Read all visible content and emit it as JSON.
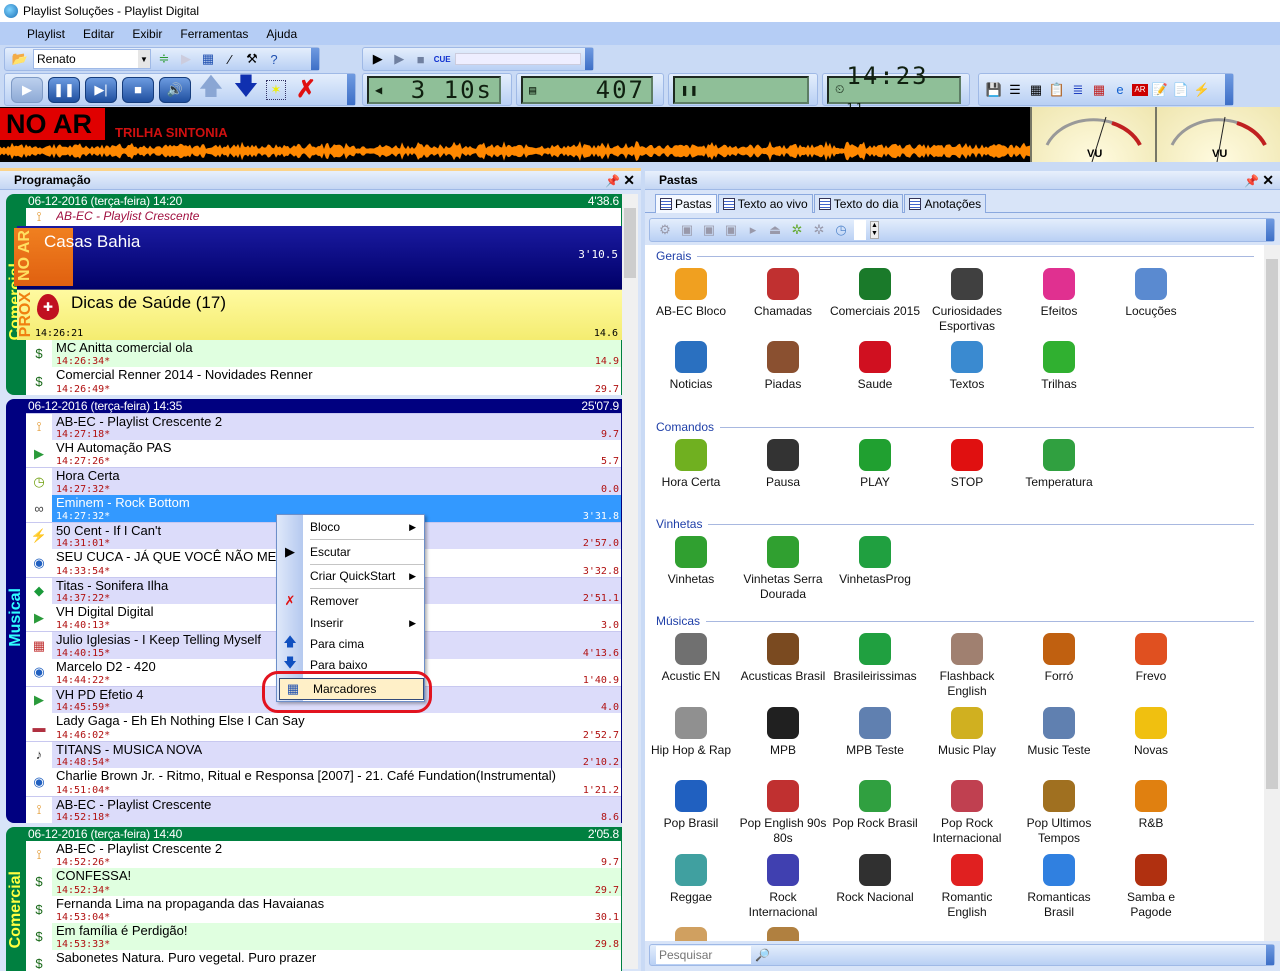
{
  "window": {
    "title": "Playlist Soluções - Playlist Digital"
  },
  "menu": [
    "Playlist",
    "Editar",
    "Exibir",
    "Ferramentas",
    "Ajuda"
  ],
  "toolbar": {
    "user_combo": "Renato",
    "cue_label": "CUE"
  },
  "displays": {
    "remaining": "3 10s",
    "count": "407",
    "clock": "14:23",
    "clock_seconds": "11"
  },
  "onair": {
    "label": "NO AR",
    "track": "TRILHA SINTONIA",
    "vu_label": "VU",
    "waveform_color": "#ff8800"
  },
  "left_panel": {
    "title": "Programação",
    "blocks": [
      {
        "kind": "com",
        "label": "Comercial",
        "header": "06-12-2016 (terça-feira) 14:20",
        "total": "4'38.6",
        "pre": {
          "title": "AB-EC - Playlist Crescente"
        },
        "now": {
          "badge": "NO AR",
          "title": "Casas Bahia",
          "duration": "3'10.5"
        },
        "next": {
          "badge": "PROX",
          "title": "Dicas de Saúde (17)",
          "time": "14:26:21",
          "duration": "14.6"
        },
        "rows": [
          {
            "title": "MC Anitta comercial ola",
            "time": "14:26:34*",
            "duration": "14.9",
            "bg": "g",
            "icon": "money-bag"
          },
          {
            "title": "Comercial Renner 2014 - Novidades Renner",
            "time": "14:26:49*",
            "duration": "29.7",
            "bg": "w",
            "icon": "money-bag"
          }
        ]
      },
      {
        "kind": "mus",
        "label": "Musical",
        "header": "06-12-2016 (terça-feira) 14:35",
        "total": "25'07.9",
        "rows": [
          {
            "title": "AB-EC - Playlist Crescente 2",
            "time": "14:27:18*",
            "duration": "9.7",
            "bg": "l",
            "icon": "antenna"
          },
          {
            "title": "VH Automação PAS",
            "time": "14:27:26*",
            "duration": "5.7",
            "bg": "w",
            "icon": "play"
          },
          {
            "title": "Hora Certa",
            "time": "14:27:32*",
            "duration": "0.0",
            "bg": "l",
            "icon": "clock"
          },
          {
            "title": "Eminem - Rock Bottom",
            "time": "14:27:32*",
            "duration": "3'31.8",
            "bg": "sel",
            "icon": "speakers"
          },
          {
            "title": "50 Cent - If I Can't",
            "time": "14:31:01*",
            "duration": "2'57.0",
            "bg": "l",
            "icon": "winamp"
          },
          {
            "title": "SEU CUCA -  JÁ QUE VOCÊ NÃO ME CONHECE",
            "time": "14:33:54*",
            "duration": "3'32.8",
            "bg": "w",
            "icon": "media-player"
          },
          {
            "title": "Titas - Sonifera Ilha",
            "time": "14:37:22*",
            "duration": "2'51.1",
            "bg": "l",
            "icon": "brazil-flag"
          },
          {
            "title": "VH Digital Digital",
            "time": "14:40:13*",
            "duration": "3.0",
            "bg": "w",
            "icon": "play"
          },
          {
            "title": "Julio Iglesias - I Keep Telling Myself",
            "time": "14:40:15*",
            "duration": "4'13.6",
            "bg": "l",
            "icon": "cube"
          },
          {
            "title": "Marcelo D2 - 420",
            "time": "14:44:22*",
            "duration": "1'40.9",
            "bg": "w",
            "icon": "media-player"
          },
          {
            "title": "VH PD Efetio 4",
            "time": "14:45:59*",
            "duration": "4.0",
            "bg": "l",
            "icon": "play"
          },
          {
            "title": "Lady Gaga - Eh Eh Nothing Else I Can Say",
            "time": "14:46:02*",
            "duration": "2'52.7",
            "bg": "w",
            "icon": "us-flag"
          },
          {
            "title": "TITANS - MUSICA NOVA",
            "time": "14:48:54*",
            "duration": "2'10.2",
            "bg": "l",
            "icon": "guitar"
          },
          {
            "title": "Charlie Brown Jr. - Ritmo, Ritual e Responsa [2007] - 21. Café Fundation(Instrumental)",
            "time": "14:51:04*",
            "duration": "1'21.2",
            "bg": "w",
            "icon": "media-player"
          },
          {
            "title": "AB-EC - Playlist Crescente",
            "time": "14:52:18*",
            "duration": "8.6",
            "bg": "l",
            "icon": "antenna"
          }
        ]
      },
      {
        "kind": "com",
        "label": "Comercial",
        "header": "06-12-2016 (terça-feira) 14:40",
        "total": "2'05.8",
        "rows": [
          {
            "title": "AB-EC - Playlist Crescente 2",
            "time": "14:52:26*",
            "duration": "9.7",
            "bg": "w",
            "icon": "antenna"
          },
          {
            "title": "CONFESSA!",
            "time": "14:52:34*",
            "duration": "29.7",
            "bg": "g",
            "icon": "money-bag"
          },
          {
            "title": "Fernanda Lima na propaganda das Havaianas",
            "time": "14:53:04*",
            "duration": "30.1",
            "bg": "w",
            "icon": "money-bag"
          },
          {
            "title": "Em família é Perdigão!",
            "time": "14:53:33*",
            "duration": "29.8",
            "bg": "g",
            "icon": "money-bag"
          },
          {
            "title": "Sabonetes Natura. Puro vegetal. Puro prazer",
            "time": "",
            "duration": "",
            "bg": "w",
            "icon": "money-bag"
          }
        ]
      }
    ]
  },
  "context_menu": [
    {
      "label": "Bloco",
      "submenu": true,
      "icon": ""
    },
    {
      "label": "Escutar",
      "icon": "play"
    },
    {
      "label": "Criar QuickStart",
      "submenu": true,
      "icon": ""
    },
    {
      "label": "Remover",
      "icon": "red-x"
    },
    {
      "label": "Inserir",
      "submenu": true,
      "icon": ""
    },
    {
      "label": "Para cima",
      "icon": "arrow-up"
    },
    {
      "label": "Para baixo",
      "icon": "arrow-down"
    },
    {
      "label": "Marcadores",
      "icon": "grid",
      "highlighted": true
    }
  ],
  "right_panel": {
    "title": "Pastas",
    "tabs": [
      "Pastas",
      "Texto ao vivo",
      "Texto do dia",
      "Anotações"
    ],
    "search_placeholder": "Pesquisar",
    "sections": [
      {
        "name": "Gerais",
        "items": [
          {
            "label": "AB-EC Bloco",
            "color": "#f0a020"
          },
          {
            "label": "Chamadas",
            "color": "#c03030"
          },
          {
            "label": "Comerciais 2015",
            "color": "#1a7a2a"
          },
          {
            "label": "Curiosidades Esportivas",
            "color": "#404040"
          },
          {
            "label": "Efeitos",
            "color": "#e03090"
          },
          {
            "label": "Locuções",
            "color": "#5a8ad0"
          },
          {
            "label": "Noticias",
            "color": "#2a70c0"
          },
          {
            "label": "Piadas",
            "color": "#8a5030"
          },
          {
            "label": "Saude",
            "color": "#d01020"
          },
          {
            "label": "Textos",
            "color": "#3a8ad0"
          },
          {
            "label": "Trilhas",
            "color": "#30b030"
          }
        ]
      },
      {
        "name": "Comandos",
        "items": [
          {
            "label": "Hora Certa",
            "color": "#70b020"
          },
          {
            "label": "Pausa",
            "color": "#333333"
          },
          {
            "label": "PLAY",
            "color": "#20a030"
          },
          {
            "label": "STOP",
            "color": "#e01010"
          },
          {
            "label": "Temperatura",
            "color": "#30a040"
          }
        ]
      },
      {
        "name": "Vinhetas",
        "items": [
          {
            "label": "Vinhetas",
            "color": "#30a030"
          },
          {
            "label": "Vinhetas Serra Dourada",
            "color": "#30a030"
          },
          {
            "label": "VinhetasProg",
            "color": "#20a040"
          }
        ]
      },
      {
        "name": "Músicas",
        "items": [
          {
            "label": "Acustic EN",
            "color": "#707070"
          },
          {
            "label": "Acusticas Brasil",
            "color": "#7a4a20"
          },
          {
            "label": "Brasileirissimas",
            "color": "#20a040"
          },
          {
            "label": "Flashback English",
            "color": "#a08070"
          },
          {
            "label": "Forró",
            "color": "#c06010"
          },
          {
            "label": "Frevo",
            "color": "#e05020"
          },
          {
            "label": "Hip Hop & Rap",
            "color": "#909090"
          },
          {
            "label": "MPB",
            "color": "#202020"
          },
          {
            "label": "MPB Teste",
            "color": "#6080b0"
          },
          {
            "label": "Music Play",
            "color": "#d0b020"
          },
          {
            "label": "Music Teste",
            "color": "#6080b0"
          },
          {
            "label": "Novas",
            "color": "#f0c010"
          },
          {
            "label": "Pop Brasil",
            "color": "#2060c0"
          },
          {
            "label": "Pop English 90s 80s",
            "color": "#c03030"
          },
          {
            "label": "Pop Rock Brasil",
            "color": "#30a040"
          },
          {
            "label": "Pop Rock Internacional",
            "color": "#c04050"
          },
          {
            "label": "Pop Ultimos Tempos",
            "color": "#a07020"
          },
          {
            "label": "R&B",
            "color": "#e08010"
          },
          {
            "label": "Reggae",
            "color": "#40a0a0"
          },
          {
            "label": "Rock Internacional",
            "color": "#4040b0"
          },
          {
            "label": "Rock Nacional",
            "color": "#303030"
          },
          {
            "label": "Romantic English",
            "color": "#e02020"
          },
          {
            "label": "Romanticas Brasil",
            "color": "#3080e0"
          },
          {
            "label": "Samba e Pagode",
            "color": "#b03010"
          },
          {
            "label": "",
            "color": "#d0a060"
          },
          {
            "label": "",
            "color": "#b08040"
          }
        ]
      }
    ]
  }
}
